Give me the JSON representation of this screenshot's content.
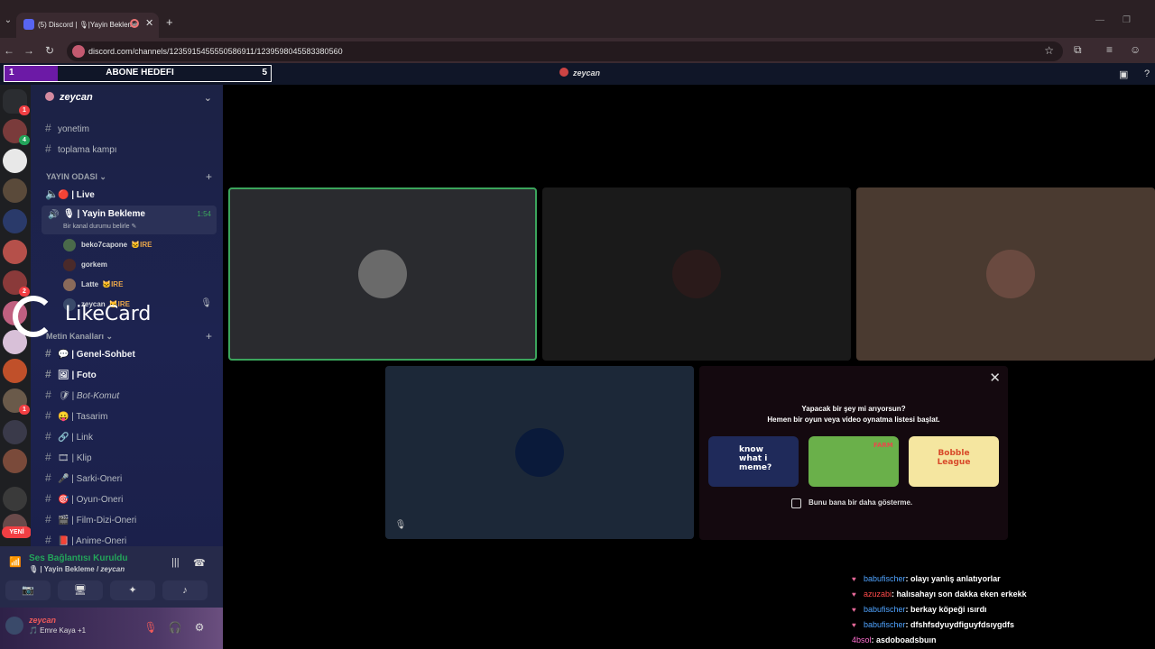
{
  "browser": {
    "tab_title": "(5) Discord | 🎙|Yayin Bekleme",
    "url": "discord.com/channels/1235915455550586911/1239598045583380560"
  },
  "overlay": {
    "goal_current": "1",
    "goal_label": "ABONE HEDEFI",
    "goal_target": "5",
    "goal_progress": 0.2,
    "streamer": "zeycan"
  },
  "server": {
    "name": "zeycan",
    "top_channels": [
      {
        "label": "yonetim"
      },
      {
        "label": "toplama kampı"
      }
    ],
    "category_voice": "YAYIN ODASI",
    "live_channel": "🔴 | Live",
    "active_channel": {
      "label": "🎙 | Yayin Bekleme",
      "timer": "1:54",
      "status": "Bir kanal durumu belirle"
    },
    "voice_users": [
      {
        "name": "beko7capone",
        "tag": "🐱IRE"
      },
      {
        "name": "gorkem",
        "tag": ""
      },
      {
        "name": "Latte",
        "tag": "🐱IRE"
      },
      {
        "name": "zeycan",
        "tag": "🐱IRE"
      }
    ],
    "category_text": "Metin Kanalları",
    "text_channels": [
      {
        "label": "💬 | Genel-Sohbet"
      },
      {
        "label": "🖼 | Foto"
      },
      {
        "label": "🛡 | Bot-Komut"
      },
      {
        "label": "😛 | Tasarim"
      },
      {
        "label": "🔗 | Link"
      },
      {
        "label": "🎞 | Klip"
      },
      {
        "label": "🎤 | Sarki-Oneri"
      },
      {
        "label": "🎯 | Oyun-Oneri"
      },
      {
        "label": "🎬 | Film-Dizi-Oneri"
      },
      {
        "label": "📕 | Anime-Oneri"
      }
    ]
  },
  "rail": {
    "new_badge": "YENİ",
    "badges": [
      "1",
      "4",
      "2",
      "1"
    ]
  },
  "watermark": "LikeCard",
  "voice_panel": {
    "status": "Ses Bağlantısı Kuruldu",
    "location_channel": "🎙 | Yayin Bekleme / ",
    "location_server": "zeycan"
  },
  "user": {
    "name": "zeycan",
    "status": "🎵 Emre Kaya +1"
  },
  "promo": {
    "title": "Yapacak bir şey mi arıyorsun?",
    "subtitle": "Hemen bir oyun veya video oynatma listesi başlat.",
    "games": [
      {
        "name": "know what i meme?"
      },
      {
        "name": "FARM"
      },
      {
        "name": "Bobble League"
      }
    ],
    "checkbox_label": "Bunu bana bir daha gösterme."
  },
  "chat": [
    {
      "user": "babufischer",
      "color": "#4fa3ff",
      "text": ": olayı yanlış anlatıyorlar"
    },
    {
      "user": "azuzabi",
      "color": "#ff4a4a",
      "text": ": halısahayı son dakka eken erkekk"
    },
    {
      "user": "babufischer",
      "color": "#4fa3ff",
      "text": ": berkay köpeği ısırdı"
    },
    {
      "user": "babufischer",
      "color": "#4fa3ff",
      "text": ": dfshfsdyuydfiguyfdsıygdfs"
    },
    {
      "user": "4bsol",
      "color": "#ff6fd0",
      "text": ": asdoboadsbuın"
    }
  ],
  "icons": {
    "speaker": "speaker-icon",
    "hash": "hash-icon"
  }
}
